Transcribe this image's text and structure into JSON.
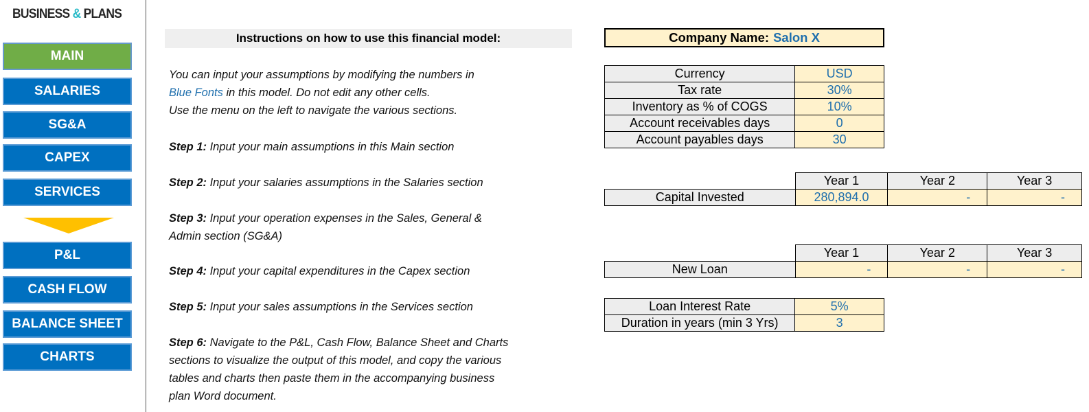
{
  "logo": {
    "part1": "BUSINESS",
    "amp": "&",
    "part2": "PLANS"
  },
  "sidebar": {
    "items": [
      {
        "label": "MAIN",
        "active": true
      },
      {
        "label": "SALARIES"
      },
      {
        "label": "SG&A"
      },
      {
        "label": "CAPEX"
      },
      {
        "label": "SERVICES"
      },
      {
        "label": "P&L"
      },
      {
        "label": "CASH FLOW"
      },
      {
        "label": "BALANCE SHEET"
      },
      {
        "label": "CHARTS"
      }
    ],
    "arrow_icon": "down-triangle-icon"
  },
  "instructions": {
    "title": "Instructions on how to use this financial model:",
    "intro_line1": "You can input your assumptions by modifying the numbers in",
    "intro_blue": "Blue Fonts",
    "intro_line2_rest": " in this model. Do not edit any other cells.",
    "intro_line3": "Use the menu on the left to navigate the various sections.",
    "steps": [
      {
        "label": "Step 1:",
        "text": " Input your main assumptions in this Main section"
      },
      {
        "label": "Step 2:",
        "text": " Input your salaries assumptions in the Salaries section"
      },
      {
        "label": "Step 3:",
        "text": " Input your operation expenses in the Sales, General &",
        "text2": "Admin section (SG&A)"
      },
      {
        "label": "Step 4:",
        "text": " Input your capital expenditures in the Capex section"
      },
      {
        "label": "Step 5:",
        "text": " Input your sales assumptions in the Services section"
      },
      {
        "label": "Step 6:",
        "text": " Navigate to the P&L, Cash Flow, Balance Sheet and Charts",
        "text2": "sections to visualize the output of this model, and copy the various",
        "text3": "tables and charts then paste them in the accompanying business",
        "text4": "plan Word document."
      }
    ]
  },
  "company": {
    "label": "Company Name:",
    "value": "Salon X"
  },
  "assumptions": [
    {
      "label": "Currency",
      "value": "USD"
    },
    {
      "label": "Tax rate",
      "value": "30%"
    },
    {
      "label": "Inventory as % of COGS",
      "value": "10%"
    },
    {
      "label": "Account receivables days",
      "value": "0"
    },
    {
      "label": "Account payables days",
      "value": "30"
    }
  ],
  "capital": {
    "years": [
      "Year 1",
      "Year 2",
      "Year 3"
    ],
    "label": "Capital Invested",
    "values": [
      "280,894.0",
      "-",
      "-"
    ]
  },
  "loan": {
    "years": [
      "Year 1",
      "Year 2",
      "Year 3"
    ],
    "label": "New Loan",
    "values": [
      "-",
      "-",
      "-"
    ]
  },
  "loan_terms": [
    {
      "label": "Loan Interest Rate",
      "value": "5%"
    },
    {
      "label": "Duration in years (min 3 Yrs)",
      "value": "3"
    }
  ]
}
